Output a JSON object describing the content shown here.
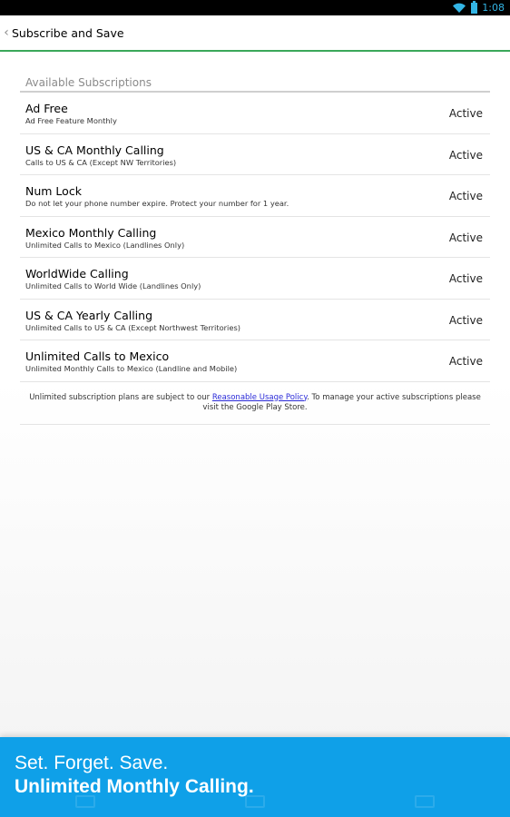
{
  "status_bar": {
    "time": "1:08"
  },
  "action_bar": {
    "title": "Subscribe and Save"
  },
  "section": {
    "header": "Available Subscriptions"
  },
  "subscriptions": [
    {
      "name": "Ad Free",
      "description": "Ad Free Feature Monthly",
      "status": "Active"
    },
    {
      "name": "US & CA Monthly Calling",
      "description": "Calls to US & CA (Except NW Territories)",
      "status": "Active"
    },
    {
      "name": "Num Lock",
      "description": "Do not let your phone number expire. Protect your number for 1 year.",
      "status": "Active"
    },
    {
      "name": "Mexico Monthly Calling",
      "description": "Unlimited Calls to Mexico (Landlines Only)",
      "status": "Active"
    },
    {
      "name": "WorldWide Calling",
      "description": "Unlimited Calls to World Wide (Landlines Only)",
      "status": "Active"
    },
    {
      "name": "US & CA Yearly Calling",
      "description": "Unlimited Calls to US & CA (Except Northwest Territories)",
      "status": "Active"
    },
    {
      "name": "Unlimited Calls to Mexico",
      "description": "Unlimited Monthly Calls to Mexico (Landline and Mobile)",
      "status": "Active"
    }
  ],
  "footer": {
    "text_before": "Unlimited subscription plans are subject to our ",
    "link_text": "Reasonable Usage Policy",
    "text_after": ". To manage your active subscriptions please visit the Google Play Store."
  },
  "promo": {
    "line1": "Set. Forget. Save.",
    "line2": "Unlimited Monthly Calling."
  },
  "icons": {
    "wifi": "wifi-icon",
    "battery": "battery-icon",
    "back": "chevron-left-icon"
  },
  "colors": {
    "accent_green": "#3aa85a",
    "promo_blue": "#0fa0e8",
    "status_blue": "#33b5e5"
  }
}
